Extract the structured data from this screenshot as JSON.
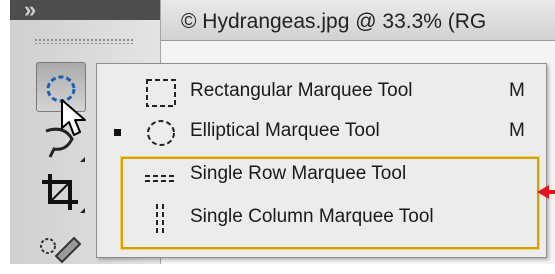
{
  "document": {
    "tab_title": "© Hydrangeas.jpg @ 33.3% (RG"
  },
  "toolbar": {
    "tools": [
      {
        "id": "marquee",
        "icon": "elliptical-marquee-icon",
        "active": true
      },
      {
        "id": "lasso",
        "icon": "lasso-icon",
        "active": false
      },
      {
        "id": "crop",
        "icon": "crop-icon",
        "active": false
      },
      {
        "id": "brush",
        "icon": "healing-brush-icon",
        "active": false
      }
    ]
  },
  "flyout": {
    "items": [
      {
        "label": "Rectangular Marquee Tool",
        "shortcut": "M",
        "icon": "rectangular-marquee-icon",
        "selected": false
      },
      {
        "label": "Elliptical Marquee Tool",
        "shortcut": "M",
        "icon": "elliptical-marquee-icon",
        "selected": true
      },
      {
        "label": "Single Row Marquee Tool",
        "shortcut": "",
        "icon": "single-row-marquee-icon",
        "selected": false
      },
      {
        "label": "Single Column Marquee Tool",
        "shortcut": "",
        "icon": "single-column-marquee-icon",
        "selected": false
      }
    ]
  },
  "annotation": {
    "highlight_color": "#d4a300",
    "arrow_color": "#e8141a"
  }
}
